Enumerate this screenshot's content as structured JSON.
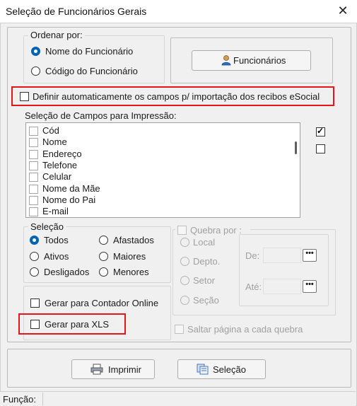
{
  "window": {
    "title": "Seleção de Funcionários Gerais",
    "close_glyph": "✕"
  },
  "ordenar": {
    "legend": "Ordenar por:",
    "options": [
      "Nome do Funcionário",
      "Código do Funcionário"
    ],
    "selected_index": 0
  },
  "funcionarios_button": {
    "label": "Funcionários",
    "icon": "user-icon"
  },
  "auto_esocial": {
    "label": "Definir automaticamente os campos p/ importação dos recibos eSocial",
    "checked": false
  },
  "campos": {
    "legend": "Seleção de Campos para Impressão:",
    "items": [
      "Cód",
      "Nome",
      "Endereço",
      "Telefone",
      "Celular",
      "Nome da Mãe",
      "Nome do Pai",
      "E-mail"
    ],
    "check_all_icon": "checked-box-icon",
    "uncheck_all_icon": "empty-box-icon"
  },
  "selecao": {
    "legend": "Seleção",
    "options": [
      "Todos",
      "Afastados",
      "Ativos",
      "Maiores",
      "Desligados",
      "Menores"
    ],
    "selected": "Todos"
  },
  "quebra": {
    "label": "Quebra por :",
    "options": [
      "Local",
      "Depto.",
      "Setor",
      "Seção"
    ],
    "de_label": "De:",
    "ate_label": "Até:",
    "dots": "•••"
  },
  "contador": {
    "label": "Gerar para Contador Online"
  },
  "xls": {
    "label": "Gerar para XLS"
  },
  "saltar": {
    "label": "Saltar página a cada quebra"
  },
  "buttons": {
    "imprimir": "Imprimir",
    "selecao": "Seleção"
  },
  "status": {
    "funcao_label": "Função:"
  },
  "colors": {
    "highlight": "#e5141d",
    "accent": "#0063b1"
  }
}
